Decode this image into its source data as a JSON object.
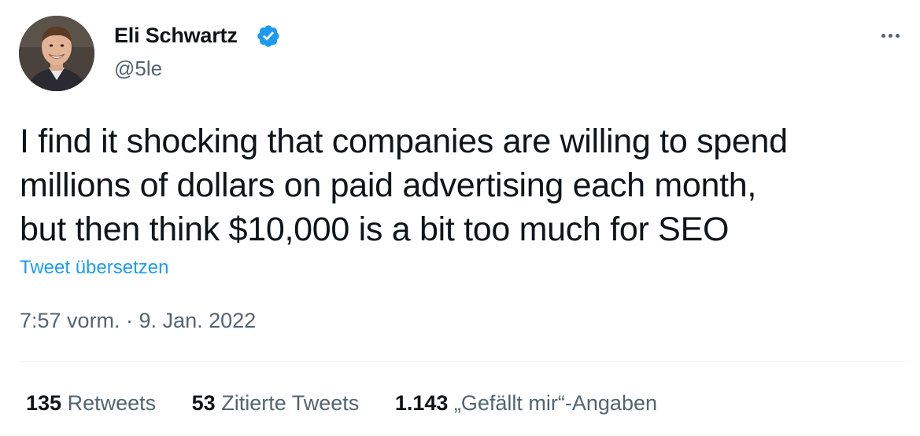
{
  "author": {
    "display_name": "Eli Schwartz",
    "handle": "@5le",
    "verified": true
  },
  "tweet": {
    "text_lines": [
      "I find it shocking that companies are willing to spend",
      "millions of dollars on paid advertising each month,",
      "but then think $10,000 is a bit too much for SEO"
    ],
    "translate_label": "Tweet übersetzen",
    "timestamp": "7:57 vorm. · 9. Jan. 2022"
  },
  "stats": {
    "retweets_count": "135",
    "retweets_label": "Retweets",
    "quotes_count": "53",
    "quotes_label": "Zitierte Tweets",
    "likes_count": "1.143",
    "likes_label": "„Gefällt mir“-Angaben"
  },
  "colors": {
    "accent": "#1d9bf0",
    "secondary_text": "#536471",
    "primary_text": "#0f1419"
  },
  "icons": {
    "verified": "verified-badge-icon",
    "more": "more-options-icon"
  }
}
